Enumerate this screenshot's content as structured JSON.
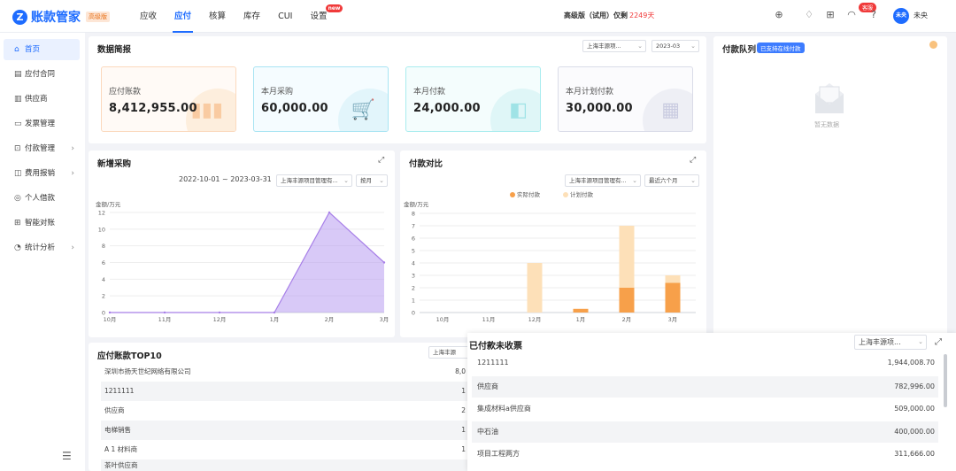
{
  "app": {
    "logo_letter": "Z",
    "name": "账款管家",
    "edition_badge": "高级版"
  },
  "nav": [
    {
      "label": "应收"
    },
    {
      "label": "应付"
    },
    {
      "label": "核算"
    },
    {
      "label": "库存"
    },
    {
      "label": "CUI"
    },
    {
      "label": "设置",
      "badge": "new"
    }
  ],
  "version": {
    "text": "高级版（试用）仅剩",
    "days": "2249天"
  },
  "header_icons": [
    "plus-circle-icon",
    "bell-icon",
    "grid-icon",
    "headset-icon",
    "question-icon"
  ],
  "support_tag": "客服",
  "user": {
    "avatar": "未央",
    "name": "未央"
  },
  "sidebar": {
    "items": [
      {
        "label": "首页",
        "icon": "home-icon",
        "glyph": "⌂"
      },
      {
        "label": "应付合同",
        "icon": "contract-icon",
        "glyph": "▤"
      },
      {
        "label": "供应商",
        "icon": "supplier-icon",
        "glyph": "▥"
      },
      {
        "label": "发票管理",
        "icon": "invoice-icon",
        "glyph": "▭"
      },
      {
        "label": "付款管理",
        "icon": "payment-icon",
        "glyph": "⊡",
        "arrow": "›"
      },
      {
        "label": "费用报销",
        "icon": "expense-icon",
        "glyph": "◫",
        "arrow": "›"
      },
      {
        "label": "个人借款",
        "icon": "loan-icon",
        "glyph": "◎"
      },
      {
        "label": "智能对账",
        "icon": "reconcile-icon",
        "glyph": "⊞"
      },
      {
        "label": "统计分析",
        "icon": "stats-icon",
        "glyph": "◔",
        "arrow": "›"
      }
    ]
  },
  "overview": {
    "title": "数据简报",
    "company_select": "上海丰源项...",
    "month_select": "2023-03",
    "kpis": [
      {
        "label": "应付账款",
        "value": "8,412,955.00",
        "icon": "bar-chart-icon",
        "color": "#f7a35c"
      },
      {
        "label": "本月采购",
        "value": "60,000.00",
        "icon": "cart-icon",
        "color": "#35c3e8"
      },
      {
        "label": "本月付款",
        "value": "24,000.00",
        "icon": "coins-icon",
        "color": "#3fd0d6"
      },
      {
        "label": "本月计划付款",
        "value": "30,000.00",
        "icon": "calendar-icon",
        "color": "#8a8fb5"
      }
    ]
  },
  "queue": {
    "title": "付款队列",
    "tag": "已支持在线付款",
    "empty_text": "暂无数据"
  },
  "chart_data": [
    {
      "type": "area",
      "title": "新增采购",
      "date_range": "2022-10-01 ~ 2023-03-31",
      "company_select": "上海丰源项目管理有...",
      "period_select": "按月",
      "ylabel": "金额/万元",
      "categories": [
        "10月",
        "11月",
        "12月",
        "1月",
        "2月",
        "3月"
      ],
      "values": [
        0,
        0,
        0,
        0,
        12,
        6
      ],
      "ylim": [
        0,
        12
      ],
      "yticks": [
        0,
        2,
        4,
        6,
        8,
        10,
        12
      ],
      "color": "#b89cf0",
      "grid": true
    },
    {
      "type": "bar",
      "stacked": true,
      "title": "付款对比",
      "company_select": "上海丰源项目管理有...",
      "period_select": "最近六个月",
      "ylabel": "金额/万元",
      "categories": [
        "10月",
        "11月",
        "12月",
        "1月",
        "2月",
        "3月"
      ],
      "series": [
        {
          "name": "实际付款",
          "values": [
            0,
            0,
            0,
            0.3,
            2,
            2.4
          ],
          "color": "#f7a04a"
        },
        {
          "name": "计划付款",
          "values": [
            0,
            0,
            4,
            0,
            5,
            0.6
          ],
          "color": "#fde0b8"
        }
      ],
      "ylim": [
        0,
        8
      ],
      "yticks": [
        0,
        1,
        2,
        3,
        4,
        5,
        6,
        7,
        8
      ],
      "legend": "top",
      "grid": true
    }
  ],
  "top10": {
    "title": "应付账款TOP10",
    "select": "上海丰源",
    "rows": [
      {
        "name": "深圳市扬天世纪网络有限公司",
        "amount": "8,0"
      },
      {
        "name": "1211111",
        "amount": "1"
      },
      {
        "name": "供应商",
        "amount": "2"
      },
      {
        "name": "电梯销售",
        "amount": "1"
      },
      {
        "name": "A 1 材料商",
        "amount": "1"
      },
      {
        "name": "茶叶供应商",
        "amount": ""
      }
    ]
  },
  "unreceived": {
    "title": "已付款未收票",
    "select": "上海丰源项...",
    "rows": [
      {
        "name": "1211111",
        "amount": "1,944,008.70"
      },
      {
        "name": "供应商",
        "amount": "782,996.00"
      },
      {
        "name": "集成材料a供应商",
        "amount": "509,000.00"
      },
      {
        "name": "中石油",
        "amount": "400,000.00"
      },
      {
        "name": "项目工程两方",
        "amount": "311,666.00"
      }
    ]
  }
}
